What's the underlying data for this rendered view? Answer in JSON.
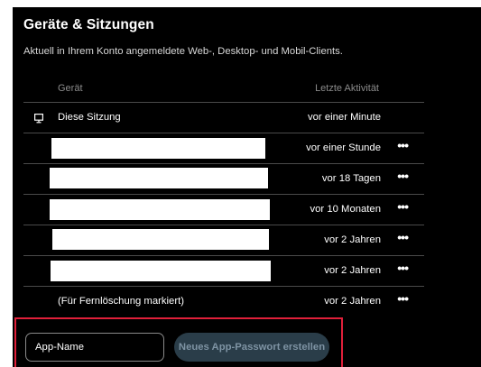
{
  "section": {
    "title": "Geräte & Sitzungen",
    "subtitle": "Aktuell in Ihrem Konto angemeldete Web-, Desktop- und Mobil-Clients."
  },
  "table": {
    "headers": {
      "device": "Gerät",
      "activity": "Letzte Aktivität"
    },
    "rows": [
      {
        "device": "Diese Sitzung",
        "icon": "monitor-icon",
        "activity": "vor einer Minute",
        "menu": ""
      },
      {
        "device": "",
        "redacted": true,
        "activity": "vor einer Stunde",
        "menu": "•••"
      },
      {
        "device": "",
        "redacted": true,
        "activity": "vor 18 Tagen",
        "menu": "•••"
      },
      {
        "device": "",
        "redacted": true,
        "activity": "vor 10 Monaten",
        "menu": "•••"
      },
      {
        "device": "",
        "redacted": true,
        "activity": "vor 2 Jahren",
        "menu": "•••"
      },
      {
        "device": "",
        "redacted": true,
        "activity": "vor 2 Jahren",
        "menu": "•••"
      },
      {
        "device": "(Für Fernlöschung markiert)",
        "activity": "vor 2 Jahren",
        "menu": "•••"
      }
    ]
  },
  "app_password": {
    "input_placeholder": "App-Name",
    "button_label": "Neues App-Passwort erstellen"
  },
  "colors": {
    "background": "#000000",
    "highlight_border": "#e0203a",
    "button_bg": "#2a3d49",
    "button_text": "#7e93a3"
  }
}
